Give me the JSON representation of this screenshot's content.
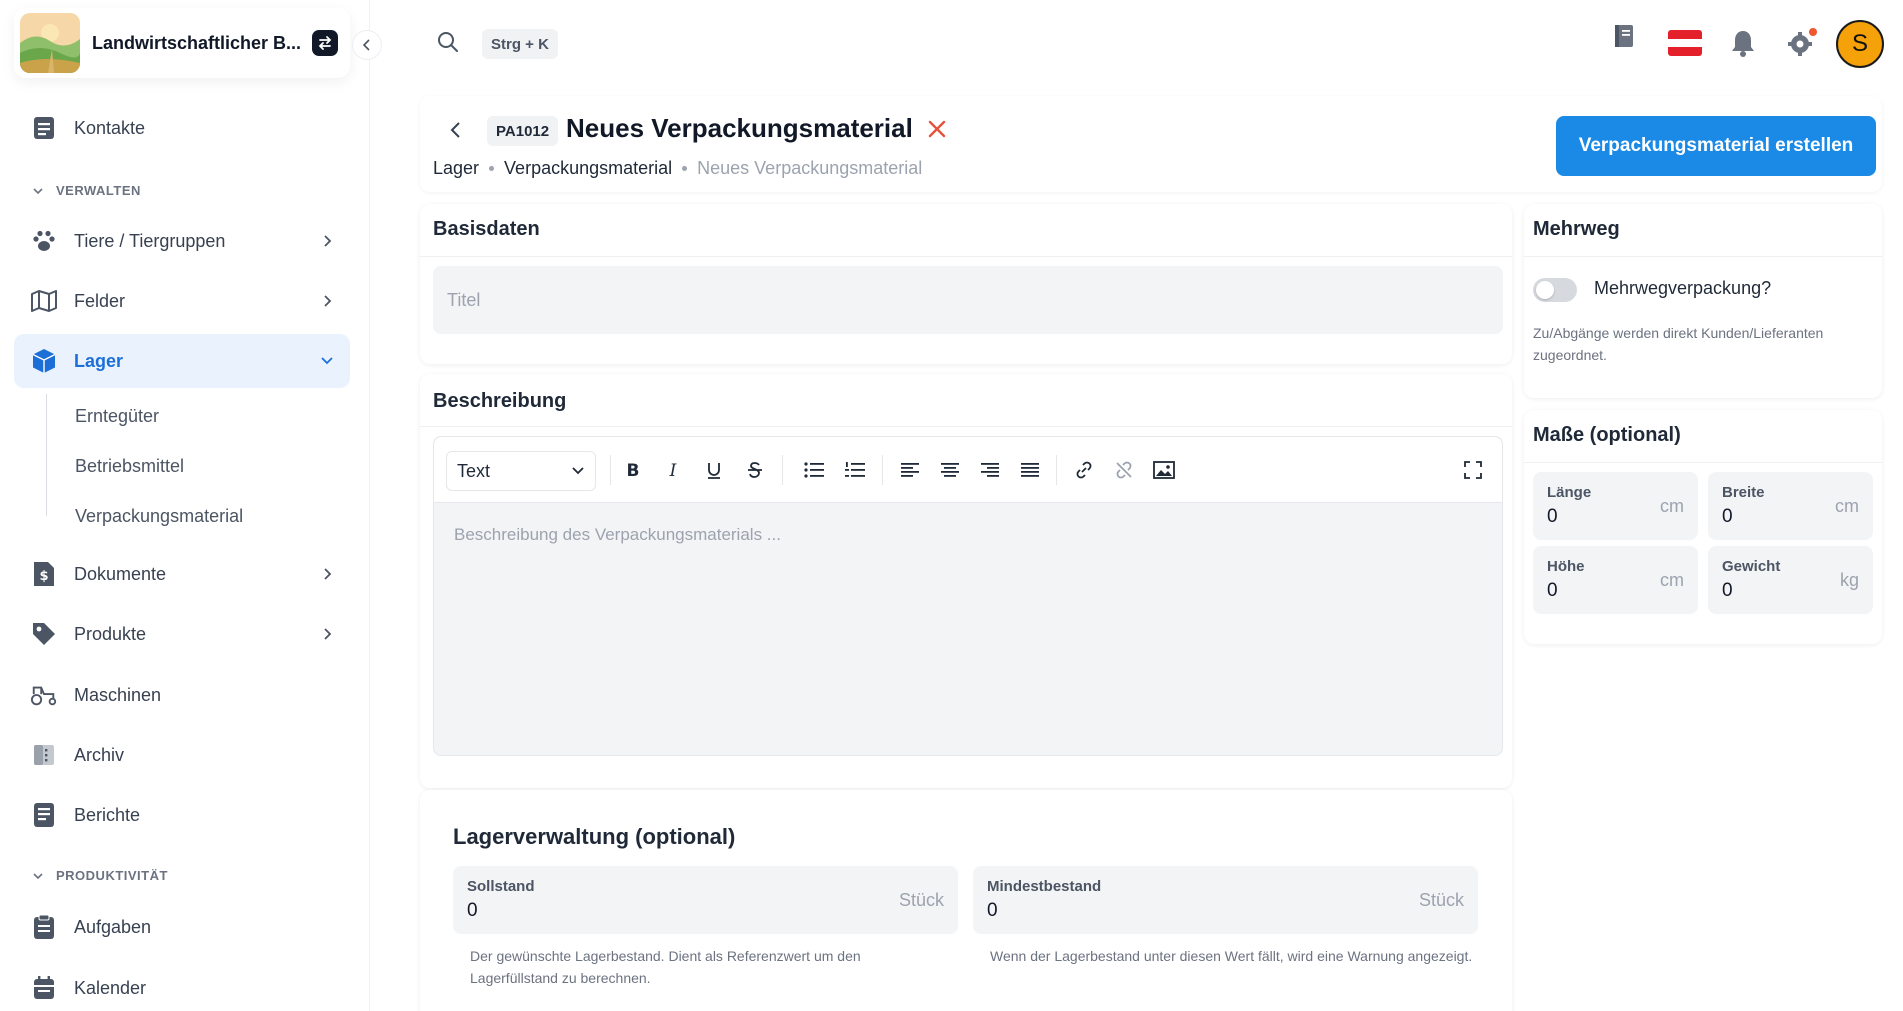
{
  "brand": {
    "name": "Landwirtschaftlicher B...",
    "logo_icon": "farm-landscape-logo"
  },
  "sidebar": {
    "items": [
      {
        "label": "Kontakte",
        "icon": "contacts-icon"
      },
      {
        "label": "Tiere / Tiergruppen",
        "icon": "paw-icon"
      },
      {
        "label": "Felder",
        "icon": "map-icon"
      },
      {
        "label": "Lager",
        "icon": "box-icon"
      },
      {
        "label": "Dokumente",
        "icon": "dollar-document-icon"
      },
      {
        "label": "Produkte",
        "icon": "tag-icon"
      },
      {
        "label": "Maschinen",
        "icon": "tractor-icon"
      },
      {
        "label": "Archiv",
        "icon": "archive-icon"
      },
      {
        "label": "Berichte",
        "icon": "report-icon"
      },
      {
        "label": "Aufgaben",
        "icon": "tasks-icon"
      },
      {
        "label": "Kalender",
        "icon": "calendar-icon"
      }
    ],
    "sections": {
      "verwalten": "VERWALTEN",
      "produktivitaet": "PRODUKTIVITÄT"
    },
    "lager_sub": [
      "Erntegüter",
      "Betriebsmittel",
      "Verpackungsmaterial"
    ]
  },
  "topbar": {
    "shortcut": "Strg + K",
    "avatar_letter": "S"
  },
  "header": {
    "badge": "PA1012",
    "title": "Neues Verpackungsmaterial",
    "breadcrumb": [
      "Lager",
      "Verpackungsmaterial",
      "Neues Verpackungsmaterial"
    ],
    "create_button": "Verpackungsmaterial erstellen"
  },
  "basisdaten": {
    "title": "Basisdaten",
    "title_placeholder": "Titel"
  },
  "beschreibung": {
    "title": "Beschreibung",
    "format_select": "Text",
    "placeholder": "Beschreibung des Verpackungsmaterials ..."
  },
  "lagerverwaltung": {
    "title": "Lagerverwaltung (optional)",
    "sollstand": {
      "label": "Sollstand",
      "value": "0",
      "unit": "Stück",
      "help": "Der gewünschte Lagerbestand. Dient als Referenzwert um den Lagerfüllstand zu berechnen."
    },
    "mindestbestand": {
      "label": "Mindestbestand",
      "value": "0",
      "unit": "Stück",
      "help": "Wenn der Lagerbestand unter diesen Wert fällt, wird eine Warnung angezeigt."
    }
  },
  "mehrweg": {
    "title": "Mehrweg",
    "toggle_label": "Mehrwegverpackung?",
    "toggle_on": false,
    "help": "Zu/Abgänge werden direkt Kunden/Lieferanten zugeordnet."
  },
  "masse": {
    "title": "Maße (optional)",
    "laenge": {
      "label": "Länge",
      "value": "0",
      "unit": "cm"
    },
    "breite": {
      "label": "Breite",
      "value": "0",
      "unit": "cm"
    },
    "hoehe": {
      "label": "Höhe",
      "value": "0",
      "unit": "cm"
    },
    "gewicht": {
      "label": "Gewicht",
      "value": "0",
      "unit": "kg"
    }
  },
  "colors": {
    "accent": "#1a8ae6",
    "active_bg": "#eaf3fd",
    "danger": "#e5533d",
    "avatar": "#f5a10a"
  }
}
